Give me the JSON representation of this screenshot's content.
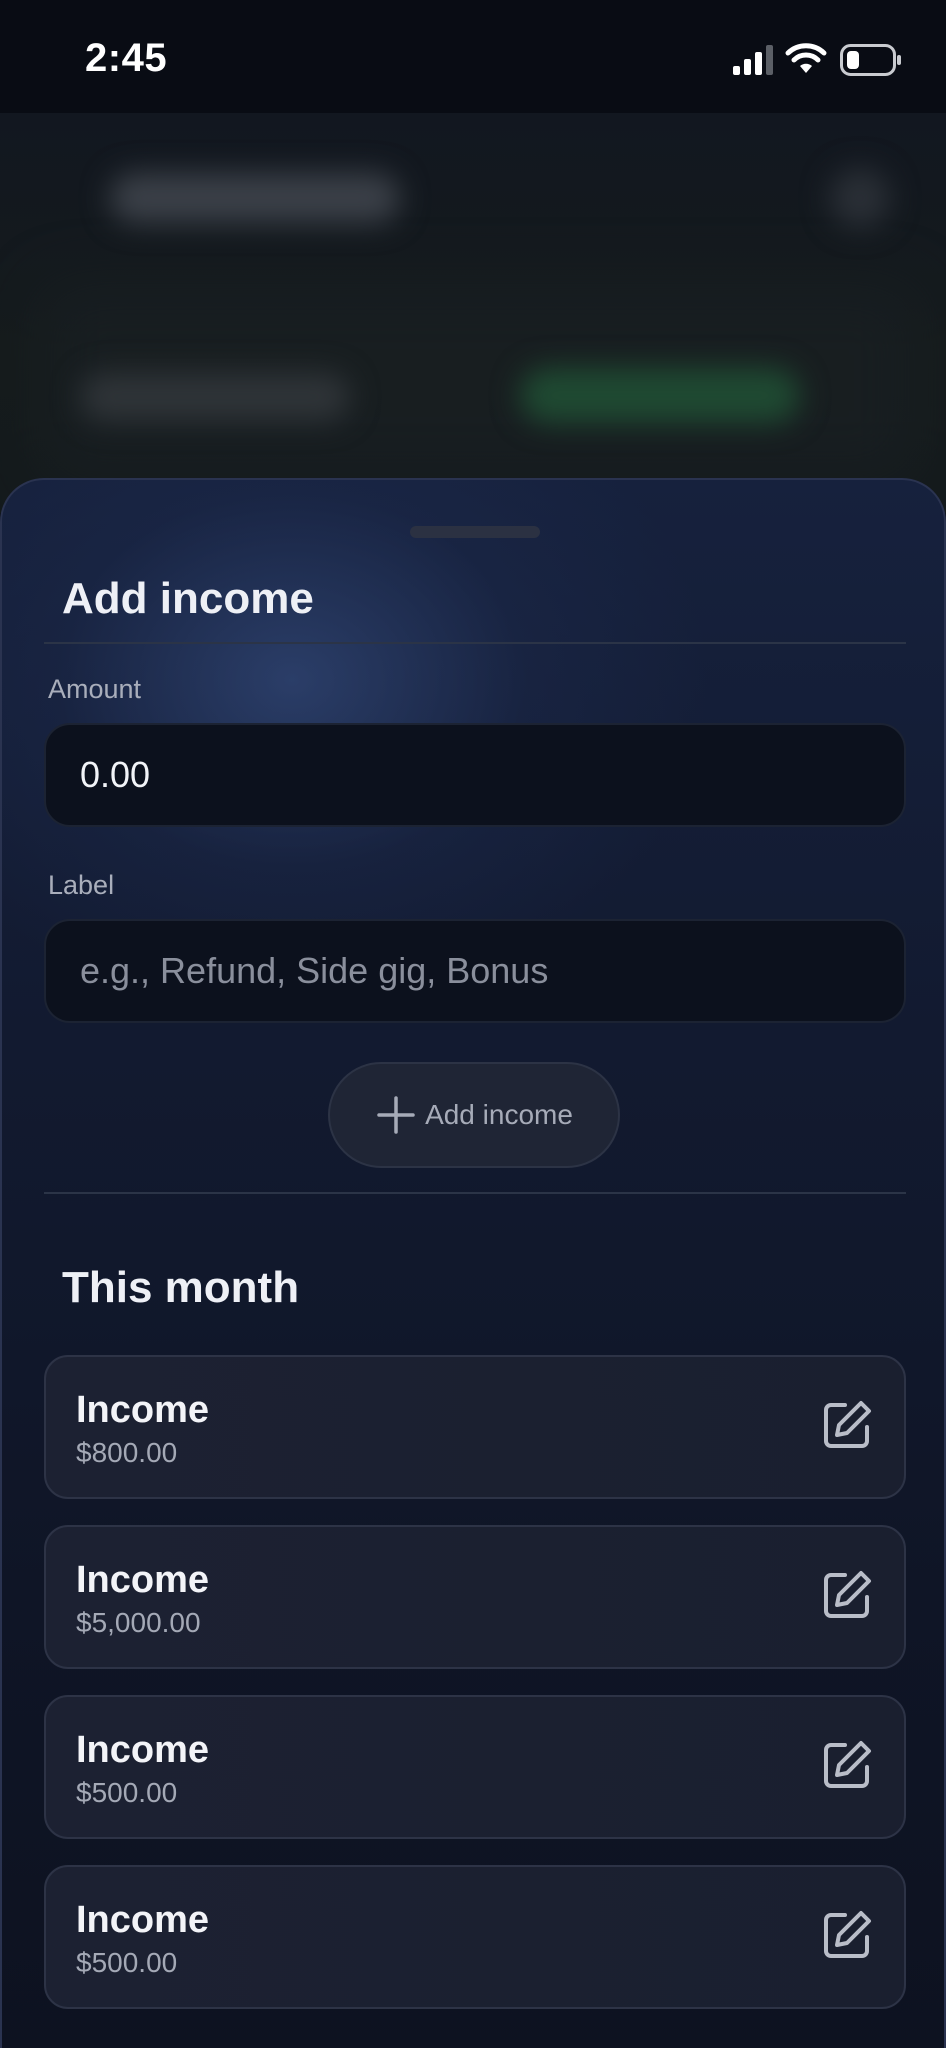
{
  "status_bar": {
    "time": "2:45",
    "icons": [
      "signal-icon",
      "wifi-icon",
      "battery-icon"
    ]
  },
  "sheet": {
    "title": "Add income",
    "amount": {
      "label": "Amount",
      "value": "",
      "placeholder": "0.00"
    },
    "label_field": {
      "label": "Label",
      "value": "",
      "placeholder": "e.g., Refund, Side gig, Bonus"
    },
    "add_button": {
      "icon": "plus-icon",
      "label": "Add income"
    }
  },
  "this_month": {
    "title": "This month",
    "items": [
      {
        "name": "Income",
        "amount": "$800.00",
        "icon": "edit-icon"
      },
      {
        "name": "Income",
        "amount": "$5,000.00",
        "icon": "edit-icon"
      },
      {
        "name": "Income",
        "amount": "$500.00",
        "icon": "edit-icon"
      },
      {
        "name": "Income",
        "amount": "$500.00",
        "icon": "edit-icon"
      }
    ]
  },
  "colors": {
    "sheet_background": "#121a30",
    "accent_text": "#eef0f6",
    "muted_text": "#a4a9b6",
    "card_background": "#1c2132"
  }
}
